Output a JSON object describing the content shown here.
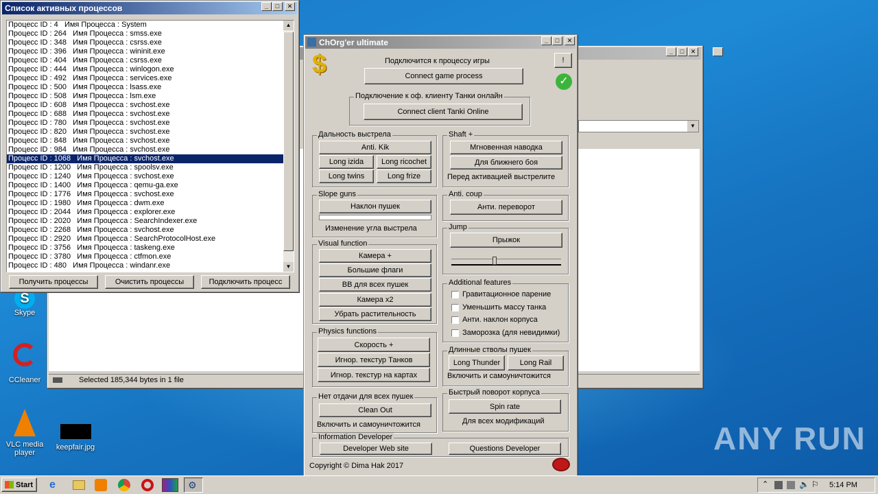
{
  "process_window": {
    "title": "Список активных процессов",
    "rows": [
      "Процесс ID : 4   Имя Процесса : System",
      "Процесс ID : 264   Имя Процесса : smss.exe",
      "Процесс ID : 348   Имя Процесса : csrss.exe",
      "Процесс ID : 396   Имя Процесса : wininit.exe",
      "Процесс ID : 404   Имя Процесса : csrss.exe",
      "Процесс ID : 444   Имя Процесса : winlogon.exe",
      "Процесс ID : 492   Имя Процесса : services.exe",
      "Процесс ID : 500   Имя Процесса : lsass.exe",
      "Процесс ID : 508   Имя Процесса : lsm.exe",
      "Процесс ID : 608   Имя Процесса : svchost.exe",
      "Процесс ID : 688   Имя Процесса : svchost.exe",
      "Процесс ID : 780   Имя Процесса : svchost.exe",
      "Процесс ID : 820   Имя Процесса : svchost.exe",
      "Процесс ID : 848   Имя Процесса : svchost.exe",
      "Процесс ID : 984   Имя Процесса : svchost.exe",
      "Процесс ID : 1068   Имя Процесса : svchost.exe",
      "Процесс ID : 1200   Имя Процесса : spoolsv.exe",
      "Процесс ID : 1240   Имя Процесса : svchost.exe",
      "Процесс ID : 1400   Имя Процесса : qemu-ga.exe",
      "Процесс ID : 1776   Имя Процесса : svchost.exe",
      "Процесс ID : 1980   Имя Процесса : dwm.exe",
      "Процесс ID : 2044   Имя Процесса : explorer.exe",
      "Процесс ID : 2020   Имя Процесса : SearchIndexer.exe",
      "Процесс ID : 2268   Имя Процесса : svchost.exe",
      "Процесс ID : 2920   Имя Процесса : SearchProtocolHost.exe",
      "Процесс ID : 3756   Имя Процесса : taskeng.exe",
      "Процесс ID : 3780   Имя Процесса : ctfmon.exe",
      "Процесс ID : 480   Имя Процесса : windanr.exe"
    ],
    "selected_index": 15,
    "btn_get": "Получить процессы",
    "btn_clear": "Очистить процессы",
    "btn_connect": "Подключить процесс"
  },
  "bg_window": {
    "status": "Selected 185,344 bytes in 1 file"
  },
  "desktop": {
    "icons": [
      "Skype",
      "CCleaner",
      "VLC media player",
      "keepfair.jpg"
    ],
    "watermark": "ANY RUN"
  },
  "main": {
    "title": "ChOrg'er ultimate",
    "connect_label": "Подключится к процессу игры",
    "connect_btn": "Connect game process",
    "exclaim_btn": "!",
    "client_group": "Подключение к оф. клиенту Танки онлайн",
    "client_btn": "Connect client Tanki Online",
    "range_group": "Дальность выстрела",
    "anti_kik": "Anti. Kik",
    "long_izida": "Long izida",
    "long_ricochet": "Long ricochet",
    "long_twins": "Long twins",
    "long_frize": "Long frize",
    "shaft_group": "Shaft +",
    "instant_aim": "Мгновенная наводка",
    "close_combat": "Для ближнего боя",
    "shaft_note": "Перед активацией выстрелите",
    "slope_group": "Slope guns",
    "slope_btn": "Наклон пушек",
    "slope_note": "Изменение угла выстрела",
    "anticoup_group": "Anti. coup",
    "anticoup_btn": "Анти. переворот",
    "jump_group": "Jump",
    "jump_btn": "Прыжок",
    "visual_group": "Visual function",
    "camera_plus": "Камера +",
    "big_flags": "Большие флаги",
    "bb_all": "BB для всех пушек",
    "camera_x2": "Камера x2",
    "remove_plants": "Убрать растительность",
    "additional_group": "Additional features",
    "features": [
      "Гравитационное парение",
      "Уменьшить массу танка",
      "Анти. наклон корпуса",
      "Заморозка (для невидимки)"
    ],
    "physics_group": "Physics functions",
    "speed_plus": "Скорость +",
    "ignore_tanks": "Игнор. текстур Танков",
    "ignore_maps": "Игнор. текстур на картах",
    "long_barrels_group": "Длинные стволы пушек",
    "long_thunder": "Long Thunder",
    "long_rail": "Long Rail",
    "long_barrels_note": "Включить и самоуничтожится",
    "norecoil_group": "Нет отдачи для всех пушек",
    "clean_out": "Clean Out",
    "norecoil_note": "Включить и самоуничтожится",
    "spin_group": "Быстрый поворот корпуса",
    "spin_btn": "Spin rate",
    "spin_note": "Для всех модификаций",
    "info_group": "Information Developer",
    "dev_site": "Developer Web site",
    "dev_questions": "Questions Developer",
    "copyright": "Copyright © Dima Hak 2017"
  },
  "taskbar": {
    "start": "Start",
    "time": "5:14 PM"
  }
}
